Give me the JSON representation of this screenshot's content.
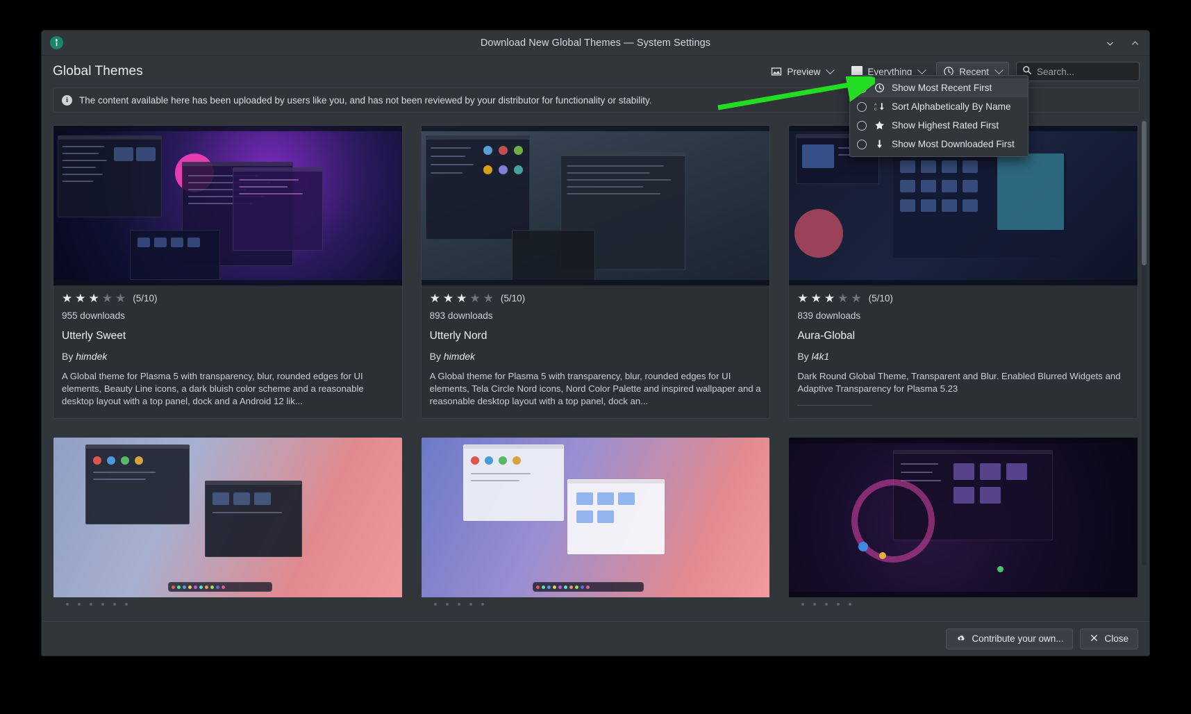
{
  "window": {
    "title": "Download New Global Themes — System Settings",
    "app_icon": "plasma-wrench-icon",
    "controls": {
      "minimize": "Minimize",
      "maximize": "Maximize"
    }
  },
  "header": {
    "page_title": "Global Themes",
    "toolbar": {
      "preview_label": "Preview",
      "filter_label": "Everything",
      "sort_label": "Recent",
      "search_placeholder": "Search...",
      "search_value": ""
    }
  },
  "banner": {
    "text": "The content available here has been uploaded by users like you, and has not been reviewed by your distributor for functionality or stability."
  },
  "sort_menu": {
    "open": true,
    "items": [
      {
        "label": "Show Most Recent First",
        "icon": "clock-icon",
        "selected": true
      },
      {
        "label": "Sort Alphabetically By Name",
        "icon": "sort-alpha-icon",
        "selected": false
      },
      {
        "label": "Show Highest Rated First",
        "icon": "star-icon",
        "selected": false
      },
      {
        "label": "Show Most Downloaded First",
        "icon": "download-arrow-icon",
        "selected": false
      }
    ]
  },
  "cards": [
    {
      "thumb": "utterly-sweet-preview",
      "thumb_class": "t1",
      "rating_stars": 3,
      "rating_total": 5,
      "rating_text": "(5/10)",
      "downloads": "955 downloads",
      "title": "Utterly Sweet",
      "author_prefix": "By",
      "author": "himdek",
      "description": "A Global theme for Plasma 5 with transparency, blur, rounded edges for UI elements, Beauty Line icons, a dark bluish color scheme and a reasonable desktop layout with a top panel, dock and a Android 12 lik..."
    },
    {
      "thumb": "utterly-nord-preview",
      "thumb_class": "t2",
      "rating_stars": 3,
      "rating_total": 5,
      "rating_text": "(5/10)",
      "downloads": "893 downloads",
      "title": "Utterly Nord",
      "author_prefix": "By",
      "author": "himdek",
      "description": "A Global theme for Plasma 5 with transparency, blur, rounded edges for UI elements, Tela Circle Nord icons, Nord Color Palette and inspired wallpaper and a reasonable desktop layout with a top panel, dock an..."
    },
    {
      "thumb": "aura-global-preview",
      "thumb_class": "t3",
      "rating_stars": 3,
      "rating_total": 5,
      "rating_text": "(5/10)",
      "downloads": "839 downloads",
      "title": "Aura-Global",
      "author_prefix": "By",
      "author": "l4k1",
      "description": "Dark Round Global Theme, Transparent and Blur. Enabled Blurred Widgets and Adaptive Transparency for Plasma 5.23"
    },
    {
      "thumb": "theme-preview-4",
      "thumb_class": "t4"
    },
    {
      "thumb": "theme-preview-5",
      "thumb_class": "t5"
    },
    {
      "thumb": "theme-preview-6",
      "thumb_class": "t6"
    }
  ],
  "footer": {
    "contribute_label": "Contribute your own...",
    "close_label": "Close"
  },
  "annotation": {
    "arrow_color": "#22dd22"
  }
}
